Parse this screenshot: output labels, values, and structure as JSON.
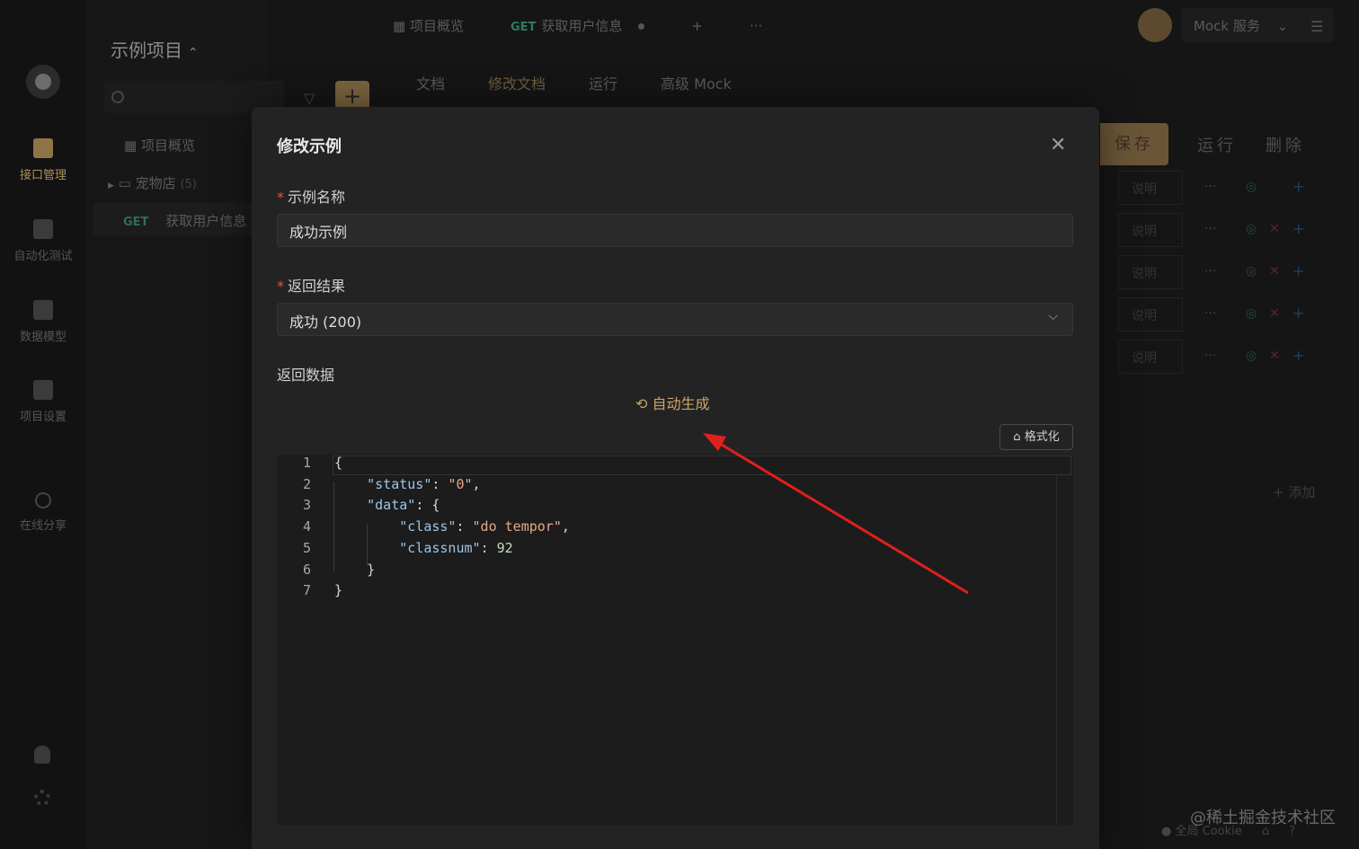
{
  "top_tabs": {
    "overview": "项目概览",
    "active_method": "GET",
    "active_name": "获取用户信息",
    "add": "+",
    "more": "···"
  },
  "header": {
    "service": "Mock 服务",
    "project": "示例项目"
  },
  "sub_tabs": [
    "文档",
    "修改文档",
    "运行",
    "高级 Mock"
  ],
  "left_nav": [
    {
      "label": "接口管理"
    },
    {
      "label": "自动化测试"
    },
    {
      "label": "数据模型"
    },
    {
      "label": "项目设置"
    },
    {
      "label": "在线分享"
    }
  ],
  "tree": {
    "overview": "项目概览",
    "folder": "宠物店",
    "folder_count": "(5)",
    "endpoint_method": "GET",
    "endpoint_name": "获取用户信息"
  },
  "actions": {
    "save": "保存",
    "run": "运行",
    "delete": "删除",
    "desc_placeholder": "说明",
    "add_row": "+ 添加"
  },
  "bottom": {
    "cookie": "全局 Cookie"
  },
  "watermark": "@稀土掘金技术社区",
  "modal": {
    "title": "修改示例",
    "close": "✕",
    "name_label": "示例名称",
    "name_value": "成功示例",
    "result_label": "返回结果",
    "result_value": "成功 (200)",
    "data_label": "返回数据",
    "autogen": "自动生成",
    "format": "格式化",
    "code_lines": [
      {
        "n": "1",
        "indent": "",
        "text": "{"
      },
      {
        "n": "2",
        "indent": "    ",
        "key": "\"status\"",
        "sep": ": ",
        "val": "\"0\"",
        "end": ","
      },
      {
        "n": "3",
        "indent": "    ",
        "key": "\"data\"",
        "sep": ": ",
        "val": "",
        "end": "{"
      },
      {
        "n": "4",
        "indent": "        ",
        "key": "\"class\"",
        "sep": ": ",
        "val": "\"do tempor\"",
        "end": ","
      },
      {
        "n": "5",
        "indent": "        ",
        "key": "\"classnum\"",
        "sep": ": ",
        "num": "92",
        "end": ""
      },
      {
        "n": "6",
        "indent": "    ",
        "text": "}"
      },
      {
        "n": "7",
        "indent": "",
        "text": "}"
      }
    ]
  },
  "colors": {
    "accent": "#c9a56a",
    "required": "#d9534f",
    "annotation_arrow": "#e0201c"
  }
}
